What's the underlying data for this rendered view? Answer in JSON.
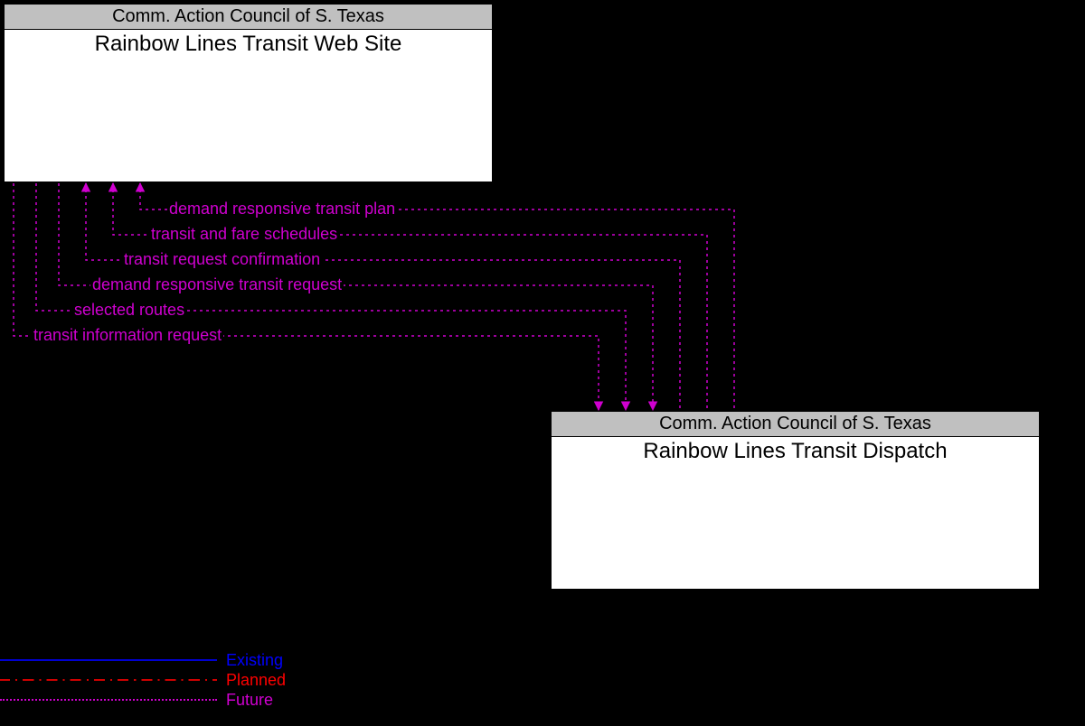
{
  "nodes": {
    "top": {
      "header": "Comm. Action Council of S. Texas",
      "title": "Rainbow Lines Transit Web Site"
    },
    "bottom": {
      "header": "Comm. Action Council of S. Texas",
      "title": "Rainbow Lines Transit Dispatch"
    }
  },
  "flows": {
    "f1": "demand responsive transit plan",
    "f2": "transit and fare schedules",
    "f3": "transit request confirmation",
    "f4": "demand responsive transit request",
    "f5": "selected routes",
    "f6": "transit information request"
  },
  "legend": {
    "existing": "Existing",
    "planned": "Planned",
    "future": "Future"
  },
  "colors": {
    "future": "#d000d0",
    "planned": "#d00000",
    "existing": "#0000d0"
  }
}
